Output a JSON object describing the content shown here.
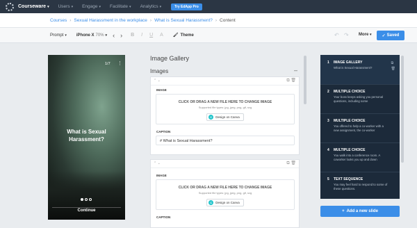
{
  "nav": {
    "brand": "Courseware",
    "items": [
      "Users",
      "Engage",
      "Facilitate",
      "Analytics"
    ],
    "try_button": "Try EdApp Pro"
  },
  "breadcrumb": {
    "items": [
      "Courses",
      "Sexual Harassment in the workplace",
      "What is Sexual Harassment?"
    ],
    "current": "Content"
  },
  "toolbar": {
    "prompt": "Prompt",
    "device": "iPhone X",
    "zoom": "70%",
    "bold": "B",
    "italic": "I",
    "underline": "U",
    "sub": "A",
    "theme": "Theme",
    "more": "More",
    "saved": "Saved"
  },
  "preview": {
    "counter": "1/7",
    "title_line1": "What is Sexual",
    "title_line2": "Harassment?",
    "continue": "Continue"
  },
  "editor": {
    "title": "Image Gallery",
    "section": "Images",
    "image_label": "IMAGE",
    "drop_text": "CLICK OR DRAG A NEW FILE HERE TO CHANGE IMAGE",
    "file_types": "Supported file types: jpg, jpeg, png, gif, svg",
    "canva_button": "Design on Canva",
    "caption_label": "CAPTION",
    "caption_value": "# What is Sexual Harassment?"
  },
  "slides": [
    {
      "num": "1",
      "title": "IMAGE GALLERY",
      "desc": "What is Sexual Harassment?"
    },
    {
      "num": "2",
      "title": "MULTIPLE CHOICE",
      "desc": "Your boss keeps asking you personal questions, including some"
    },
    {
      "num": "3",
      "title": "MULTIPLE CHOICE",
      "desc": "You offered to help a co-worker with a new assignment, the co-worker"
    },
    {
      "num": "4",
      "title": "MULTIPLE CHOICE",
      "desc": "You walk into a conference room. A coworker looks you up and down"
    },
    {
      "num": "5",
      "title": "TEXT SEQUENCE",
      "desc": "You may feel hard to respond to some of these questions."
    }
  ],
  "add_slide": "Add a new slide",
  "colors": {
    "accent": "#3b8ee8",
    "nav_bg": "#2b3644",
    "slides_bg": "#1c2a3a"
  }
}
